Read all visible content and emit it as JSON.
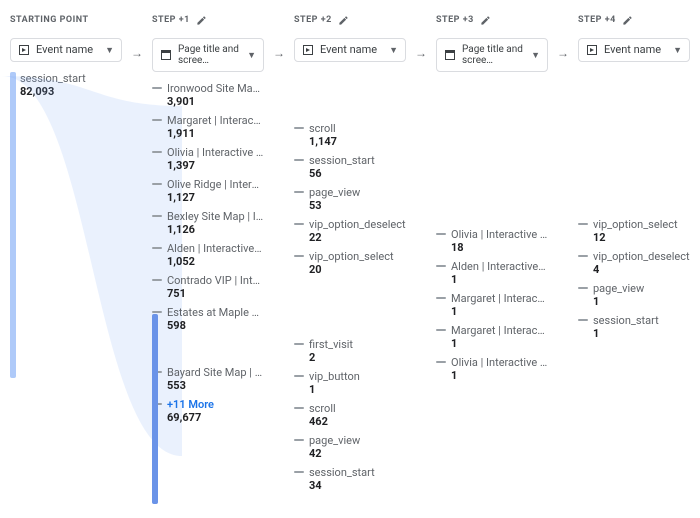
{
  "columns": [
    {
      "title": "STARTING POINT",
      "selector": "Event name",
      "selectorType": "event",
      "editable": false
    },
    {
      "title": "STEP +1",
      "selector": "Page title and scree…",
      "selectorType": "page",
      "editable": true
    },
    {
      "title": "STEP +2",
      "selector": "Event name",
      "selectorType": "event",
      "editable": true
    },
    {
      "title": "STEP +3",
      "selector": "Page title and scree…",
      "selectorType": "page",
      "editable": true
    },
    {
      "title": "STEP +4",
      "selector": "Event name",
      "selectorType": "event",
      "editable": true
    }
  ],
  "data": {
    "col0": [
      {
        "label": "session_start",
        "value": "82,093"
      }
    ],
    "col1_a": [
      {
        "label": "Ironwood Site Map | In…",
        "value": "3,901"
      },
      {
        "label": "Margaret | Interactive …",
        "value": "1,911"
      },
      {
        "label": "Olivia | Interactive Floo…",
        "value": "1,397"
      },
      {
        "label": "Olive Ridge | Interactiv…",
        "value": "1,127"
      },
      {
        "label": "Bexley Site Map | Inter…",
        "value": "1,126"
      },
      {
        "label": "Alden | Interactive Floo…",
        "value": "1,052"
      },
      {
        "label": "Contrado VIP | Interact…",
        "value": "751"
      },
      {
        "label": "Estates at Maple Ridg…",
        "value": "598"
      }
    ],
    "col1_b": [
      {
        "label": "Bayard Site Map | Inter…",
        "value": "553"
      },
      {
        "label": "+11 More",
        "value": "69,677",
        "more": true
      }
    ],
    "col2_a": [
      {
        "label": "scroll",
        "value": "1,147"
      },
      {
        "label": "session_start",
        "value": "56"
      },
      {
        "label": "page_view",
        "value": "53"
      },
      {
        "label": "vip_option_deselect",
        "value": "22"
      },
      {
        "label": "vip_option_select",
        "value": "20"
      }
    ],
    "col2_b": [
      {
        "label": "first_visit",
        "value": "2"
      },
      {
        "label": "vip_button",
        "value": "1"
      },
      {
        "label": "scroll",
        "value": "462"
      },
      {
        "label": "page_view",
        "value": "42"
      },
      {
        "label": "session_start",
        "value": "34"
      }
    ],
    "col3": [
      {
        "label": "Olivia | Interactive Floo…",
        "value": "18"
      },
      {
        "label": "Alden | Interactive Floo…",
        "value": "1"
      },
      {
        "label": "Margaret | Interactive …",
        "value": "1"
      },
      {
        "label": "Margaret | Interactive …",
        "value": "1"
      },
      {
        "label": "Olivia | Interactive Floo…",
        "value": "1"
      }
    ],
    "col4": [
      {
        "label": "vip_option_select",
        "value": "12"
      },
      {
        "label": "vip_option_deselect",
        "value": "4"
      },
      {
        "label": "page_view",
        "value": "1"
      },
      {
        "label": "session_start",
        "value": "1"
      }
    ]
  }
}
